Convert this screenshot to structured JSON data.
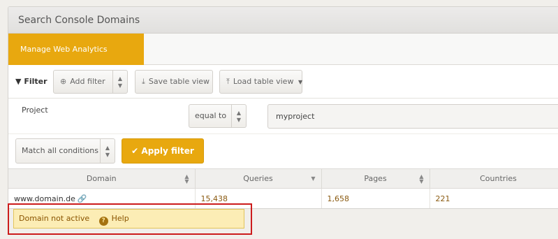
{
  "panel": {
    "title": "Search Console Domains"
  },
  "tabs": [
    {
      "label": "Manage Web Analytics accounts",
      "active": true
    }
  ],
  "filterbar": {
    "filter_label": "Filter",
    "add_filter": "Add filter",
    "save_view": "Save table view",
    "load_view": "Load table view"
  },
  "condition": {
    "field": "Project",
    "operator": "equal to",
    "value": "myproject"
  },
  "match": {
    "mode": "Match all conditions"
  },
  "apply": {
    "label": "Apply filter"
  },
  "table": {
    "columns": [
      "Domain",
      "Queries",
      "Pages",
      "Countries"
    ],
    "rows": [
      {
        "domain": "www.domain.de",
        "queries": "15,438",
        "pages": "1,658",
        "countries": "221"
      }
    ]
  },
  "alert": {
    "message": "Domain not active",
    "help": "Help"
  },
  "colors": {
    "accent": "#e8a80f",
    "alert_bg": "#fcedb5",
    "highlight": "#cc1c1c"
  }
}
